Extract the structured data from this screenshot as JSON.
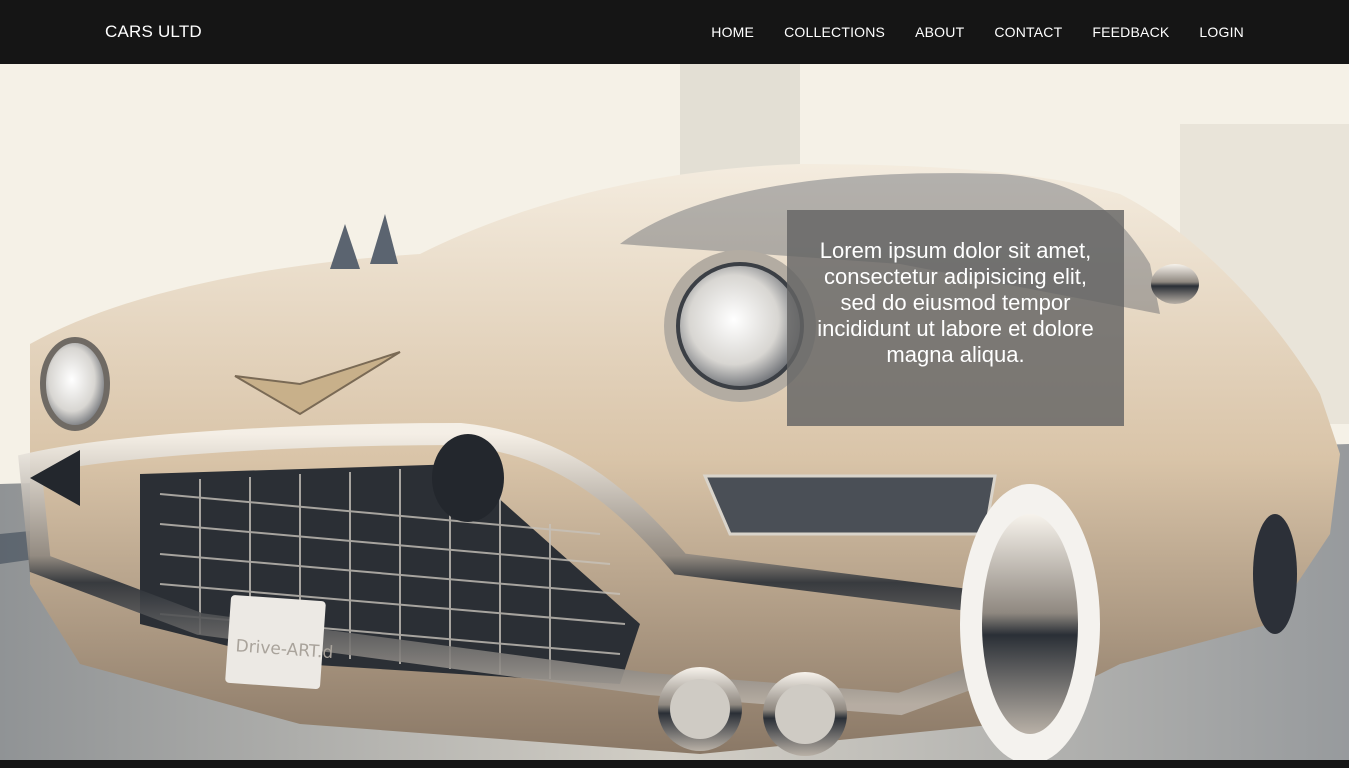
{
  "navbar": {
    "brand": "CARS ULTD",
    "links": [
      {
        "label": "HOME"
      },
      {
        "label": "COLLECTIONS"
      },
      {
        "label": "ABOUT"
      },
      {
        "label": "CONTACT"
      },
      {
        "label": "FEEDBACK"
      },
      {
        "label": "LOGIN"
      }
    ]
  },
  "hero": {
    "image": "vintage-car-photo",
    "plate_text": "Drive-ART.d",
    "caption": "Lorem ipsum dolor sit amet, consectetur adipisicing elit, sed do eiusmod tempor incididunt ut labore et dolore magna aliqua."
  },
  "colors": {
    "navbar_bg": "#151515",
    "nav_text": "#ffffff",
    "caption_bg": "#646464"
  }
}
